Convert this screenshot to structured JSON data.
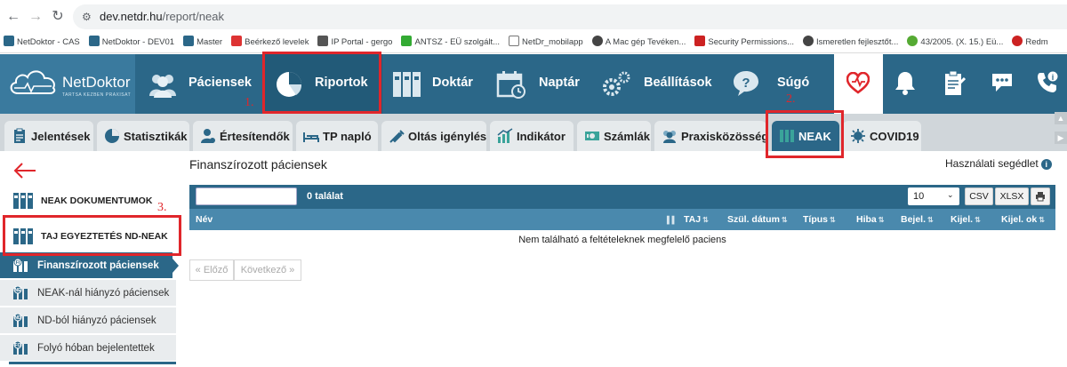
{
  "browser": {
    "url_host": "dev.netdr.hu",
    "url_path": "/report/neak",
    "bookmarks": [
      {
        "label": "NetDoktor - CAS",
        "color": "#2b6788"
      },
      {
        "label": "NetDoktor - DEV01",
        "color": "#2b6788"
      },
      {
        "label": "Master",
        "color": "#2b6788"
      },
      {
        "label": "Beérkező levelek",
        "color": "#d33"
      },
      {
        "label": "IP Portal - gergo",
        "color": "#555"
      },
      {
        "label": "ANTSZ - EÜ szolgált...",
        "color": "#3a3"
      },
      {
        "label": "NetDr_mobilapp",
        "color": "#777"
      },
      {
        "label": "A Mac gép Tevéken...",
        "color": "#444"
      },
      {
        "label": "Security Permissions...",
        "color": "#c22"
      },
      {
        "label": "Ismeretlen fejlesztőt...",
        "color": "#444"
      },
      {
        "label": "43/2005. (X. 15.) Eü...",
        "color": "#5a3"
      },
      {
        "label": "Redm",
        "color": "#c22"
      }
    ]
  },
  "app": {
    "logo_text": "NetDoktor",
    "logo_sub": "TARTSA KEZBEN PRAXISAT",
    "menu": [
      {
        "label": "Páciensek"
      },
      {
        "label": "Riportok"
      },
      {
        "label": "Doktár"
      },
      {
        "label": "Naptár"
      },
      {
        "label": "Beállítások"
      },
      {
        "label": "Súgó"
      }
    ]
  },
  "tabs": [
    {
      "label": "Jelentések"
    },
    {
      "label": "Statisztikák"
    },
    {
      "label": "Értesítendők"
    },
    {
      "label": "TP napló"
    },
    {
      "label": "Oltás igénylés"
    },
    {
      "label": "Indikátor"
    },
    {
      "label": "Számlák"
    },
    {
      "label": "Praxisközösség"
    },
    {
      "label": "NEAK"
    },
    {
      "label": "COVID19"
    }
  ],
  "sidebar": {
    "headers": [
      {
        "label": "NEAK DOKUMENTUMOK"
      },
      {
        "label": "TAJ EGYEZTETÉS ND-NEAK"
      }
    ],
    "items": [
      {
        "label": "Finanszírozott páciensek",
        "code": "FI"
      },
      {
        "label": "NEAK-nál hiányzó páciensek",
        "code": "NE"
      },
      {
        "label": "ND-ból hiányzó páciensek",
        "code": "ND"
      },
      {
        "label": "Folyó hóban bejelentettek",
        "code": "FO"
      }
    ]
  },
  "content": {
    "title": "Finanszírozott páciensek",
    "help_label": "Használati segédlet",
    "found_label": "0 találat",
    "page_size": "10",
    "buttons": {
      "csv": "CSV",
      "xlsx": "XLSX"
    },
    "columns": [
      "Név",
      "TAJ",
      "Szül. dátum",
      "Típus",
      "Hiba",
      "Bejel.",
      "Kijel.",
      "Kijel. ok"
    ],
    "empty_message": "Nem található a feltételeknek megfelelő paciens",
    "pager": {
      "prev": "« Előző",
      "next": "Következő »"
    }
  },
  "annotations": [
    "1.",
    "2.",
    "3."
  ],
  "colors": {
    "brand": "#2b6788",
    "brand_dark": "#225a78",
    "annotation": "#e0262b",
    "heart": "#e0262b"
  }
}
